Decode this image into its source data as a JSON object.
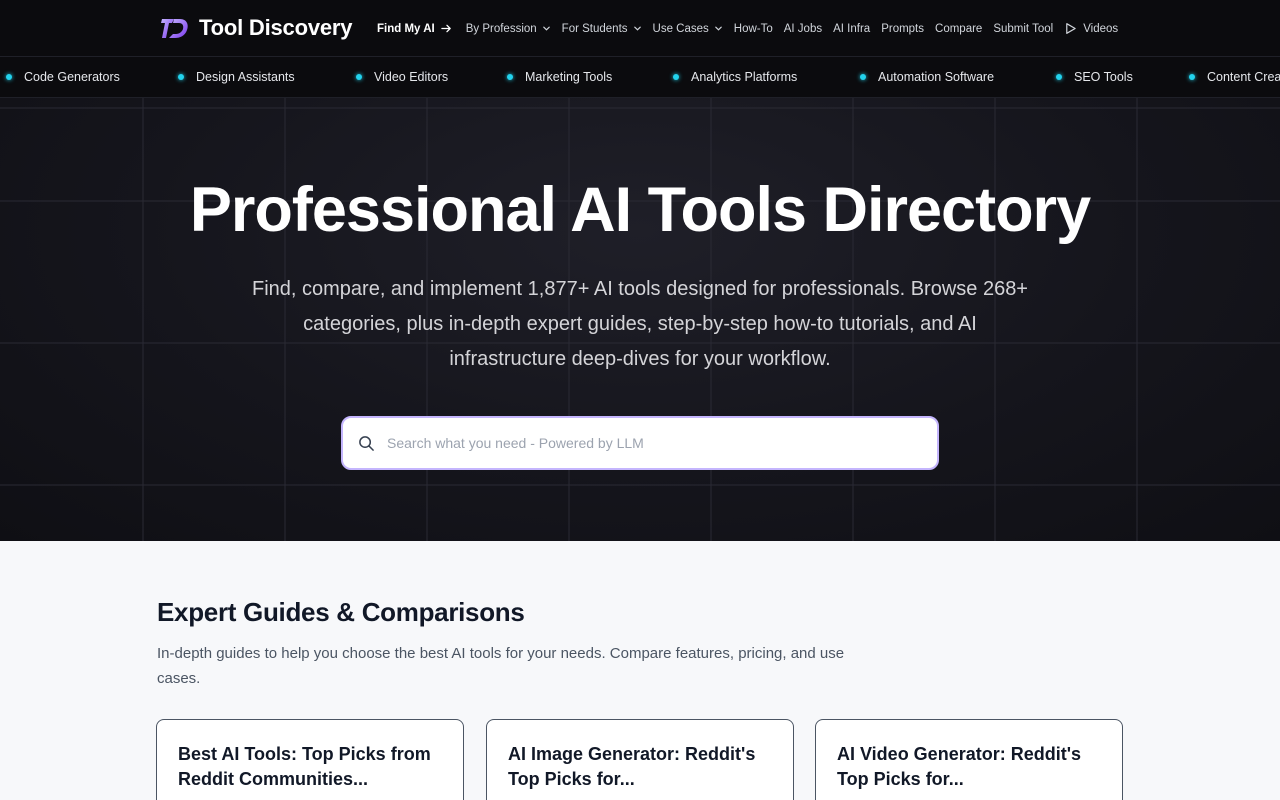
{
  "brand": {
    "logo_text": "TD",
    "name": "Tool Discovery"
  },
  "nav": {
    "primary": "Find My AI",
    "items": [
      "By Profession",
      "For Students",
      "Use Cases",
      "How-To",
      "AI Jobs",
      "AI Infra",
      "Prompts",
      "Compare",
      "Submit Tool",
      "Videos"
    ]
  },
  "categories": [
    "Code Generators",
    "Design Assistants",
    "Video Editors",
    "Marketing Tools",
    "Analytics Platforms",
    "Automation Software",
    "SEO Tools",
    "Content Creation"
  ],
  "hero": {
    "title": "Professional AI Tools Directory",
    "subtitle": "Find, compare, and implement 1,877+ AI tools designed for professionals. Browse 268+ categories, plus in-depth expert guides, step-by-step how-to tutorials, and AI infrastructure deep-dives for your workflow.",
    "search_placeholder": "Search what you need - Powered by LLM"
  },
  "guides": {
    "title": "Expert Guides & Comparisons",
    "subtitle": "In-depth guides to help you choose the best AI tools for your needs. Compare features, pricing, and use cases.",
    "cards": [
      {
        "title": "Best AI Tools: Top Picks from Reddit Communities..."
      },
      {
        "title": "AI Image Generator: Reddit's Top Picks for..."
      },
      {
        "title": "AI Video Generator: Reddit's Top Picks for..."
      }
    ]
  },
  "colors": {
    "accent_cyan": "#22d3ee",
    "logo_purple": "#a78bfa",
    "search_border": "#c4b5fd"
  }
}
